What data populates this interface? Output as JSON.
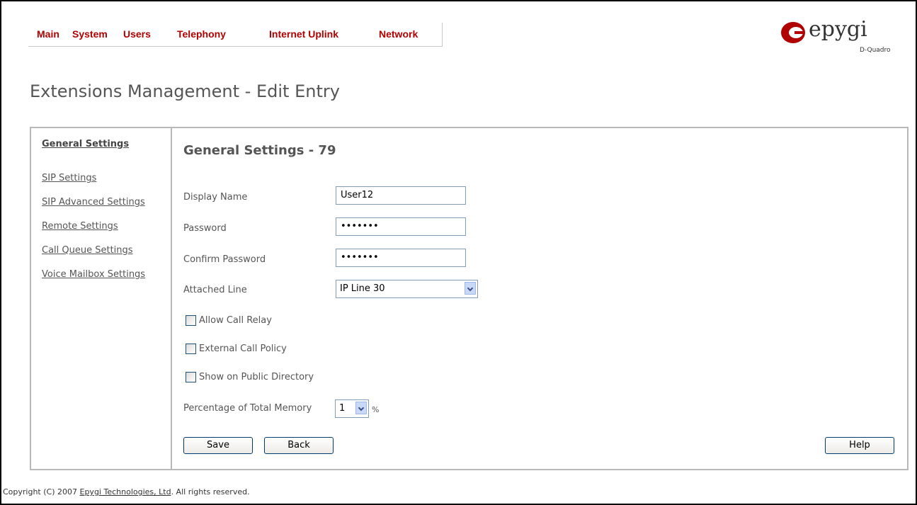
{
  "menu": {
    "items": [
      "Main",
      "System",
      "Users",
      "Telephony",
      "Internet Uplink",
      "Network"
    ]
  },
  "logo": {
    "word": "epygi",
    "model": "D-Quadro",
    "brand_color": "#b00000"
  },
  "page_title": "Extensions Management - Edit Entry",
  "sidebar": {
    "items": [
      "General Settings",
      "SIP Settings",
      "SIP Advanced Settings",
      "Remote Settings",
      "Call Queue Settings",
      "Voice Mailbox Settings"
    ]
  },
  "section_title": "General Settings - 79",
  "form": {
    "display_name_label": "Display Name",
    "display_name_value": "User12",
    "password_label": "Password",
    "password_value": "•••••••",
    "confirm_password_label": "Confirm Password",
    "confirm_password_value": "•••••••",
    "attached_line_label": "Attached Line",
    "attached_line_value": "IP Line 30",
    "allow_call_relay_label": "Allow Call Relay",
    "allow_call_relay_checked": false,
    "external_call_policy_label": "External Call Policy",
    "external_call_policy_checked": false,
    "show_public_directory_label": "Show on Public Directory",
    "show_public_directory_checked": false,
    "memory_label": "Percentage of Total Memory",
    "memory_value": "1",
    "memory_unit": "%"
  },
  "buttons": {
    "save": "Save",
    "back": "Back",
    "help": "Help"
  },
  "footer": {
    "prefix": "Copyright (C) 2007 ",
    "company": "Epygi Technologies, Ltd",
    "suffix": ". All rights reserved."
  }
}
